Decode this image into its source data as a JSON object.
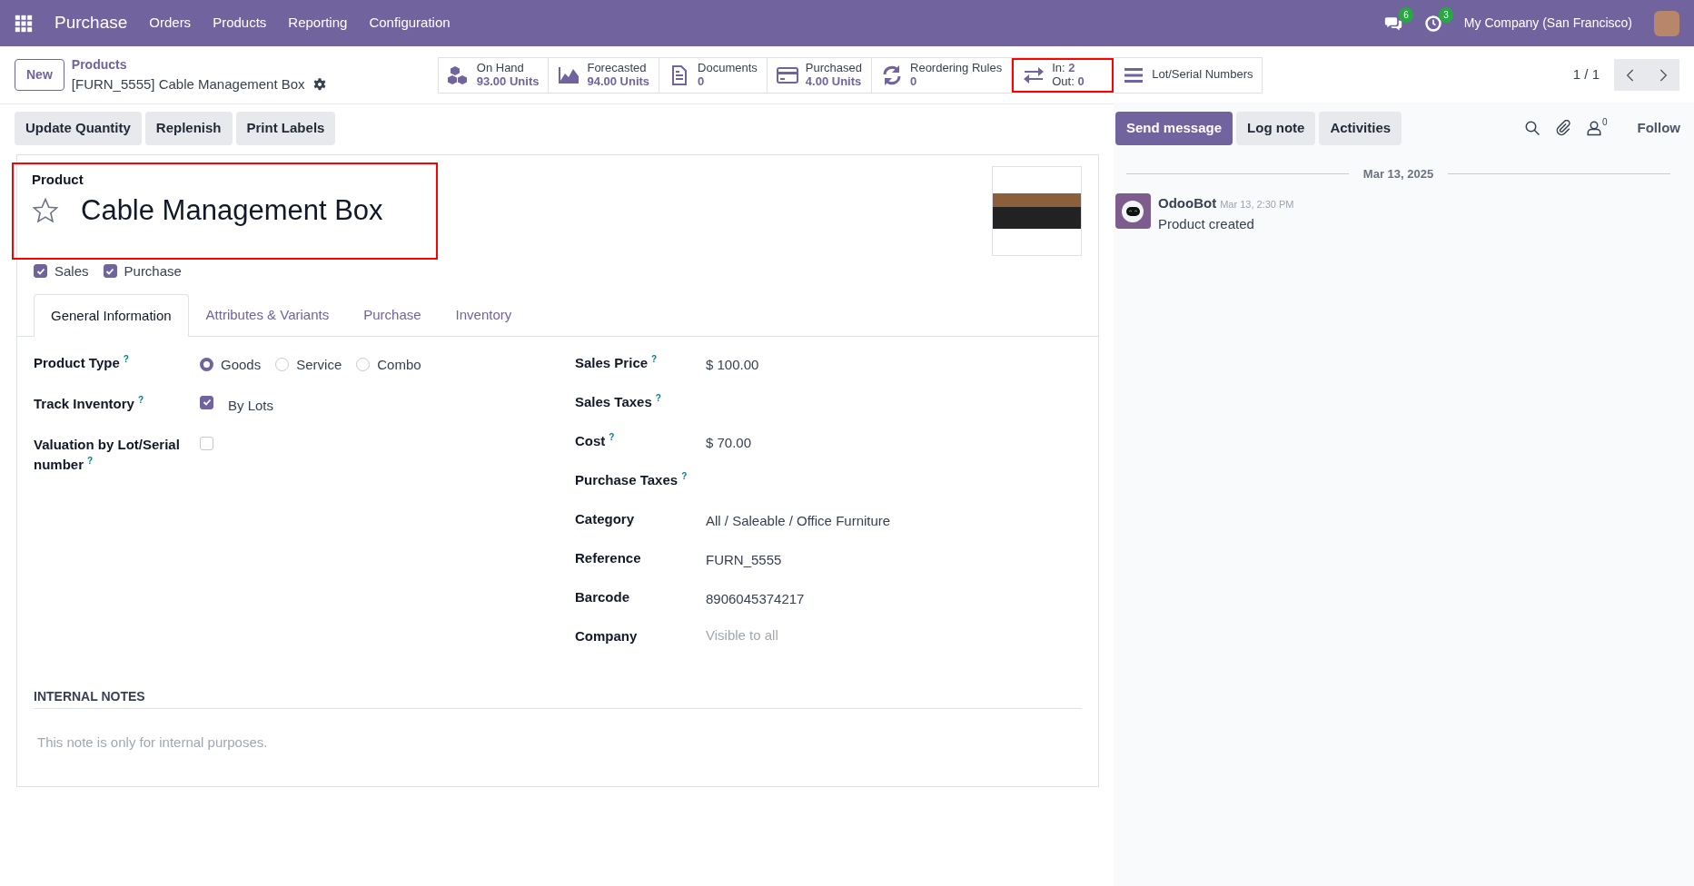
{
  "navbar": {
    "app": "Purchase",
    "menus": [
      "Orders",
      "Products",
      "Reporting",
      "Configuration"
    ],
    "messages_count": "6",
    "activities_count": "3",
    "company": "My Company (San Francisco)"
  },
  "control_panel": {
    "new_button": "New",
    "breadcrumb": "Products",
    "record": "[FURN_5555] Cable Management Box",
    "pager": "1 / 1",
    "smart_buttons": [
      {
        "kind": "stat",
        "label": "On Hand",
        "value": "93.00 Units",
        "highlighted": false
      },
      {
        "kind": "stat",
        "label": "Forecasted",
        "value": "94.00 Units",
        "highlighted": false
      },
      {
        "kind": "stat",
        "label": "Documents",
        "value": "0",
        "highlighted": false
      },
      {
        "kind": "stat",
        "label": "Purchased",
        "value": "4.00 Units",
        "highlighted": false
      },
      {
        "kind": "stat",
        "label": "Reordering Rules",
        "value": "0",
        "highlighted": false
      },
      {
        "kind": "inout",
        "in_label": "In:",
        "in_value": "2",
        "out_label": "Out:",
        "out_value": "0",
        "highlighted": true
      },
      {
        "kind": "single",
        "label": "Lot/Serial Numbers",
        "highlighted": false
      }
    ]
  },
  "actions": [
    "Update Quantity",
    "Replenish",
    "Print Labels"
  ],
  "form": {
    "title_label": "Product",
    "name": "Cable Management Box",
    "favorite": false,
    "highlighted": true,
    "options": [
      {
        "label": "Sales",
        "checked": true
      },
      {
        "label": "Purchase",
        "checked": true
      }
    ],
    "tabs": [
      {
        "label": "General Information",
        "selected": true
      },
      {
        "label": "Attributes & Variants",
        "selected": false
      },
      {
        "label": "Purchase",
        "selected": false
      },
      {
        "label": "Inventory",
        "selected": false
      }
    ],
    "left_fields": [
      {
        "kind": "radio",
        "label": "Product Type",
        "help": "?",
        "options": [
          {
            "label": "Goods",
            "selected": true
          },
          {
            "label": "Service",
            "selected": false
          },
          {
            "label": "Combo",
            "selected": false
          }
        ]
      },
      {
        "kind": "checkbox",
        "label": "Track Inventory",
        "help": "?",
        "checked": true,
        "value": "By Lots"
      },
      {
        "kind": "checkbox",
        "label": "Valuation by Lot/Serial number",
        "help": "?",
        "checked": false
      }
    ],
    "right_fields": [
      {
        "kind": "text",
        "label": "Sales Price",
        "help": "?",
        "value": "$ 100.00"
      },
      {
        "kind": "text",
        "label": "Sales Taxes",
        "help": "?"
      },
      {
        "kind": "text",
        "label": "Cost",
        "help": "?",
        "value": "$ 70.00"
      },
      {
        "kind": "text",
        "label": "Purchase Taxes",
        "help": "?"
      },
      {
        "kind": "text",
        "label": "Category",
        "value": "All / Saleable / Office Furniture"
      },
      {
        "kind": "text",
        "label": "Reference",
        "value": "FURN_5555"
      },
      {
        "kind": "text",
        "label": "Barcode",
        "value": "8906045374217"
      },
      {
        "kind": "text",
        "label": "Company",
        "placeholder": "Visible to all"
      }
    ],
    "notes": {
      "heading": "INTERNAL NOTES",
      "placeholder": "This note is only for internal purposes."
    }
  },
  "chatter": {
    "buttons": [
      {
        "label": "Send message",
        "primary": true
      },
      {
        "label": "Log note",
        "primary": false
      },
      {
        "label": "Activities",
        "primary": false
      }
    ],
    "followers_count": "0",
    "follow": "Follow",
    "date": "Mar 13, 2025",
    "messages": [
      {
        "author": "OdooBot",
        "time": "Mar 13, 2:30 PM",
        "body": "Product created"
      }
    ]
  }
}
